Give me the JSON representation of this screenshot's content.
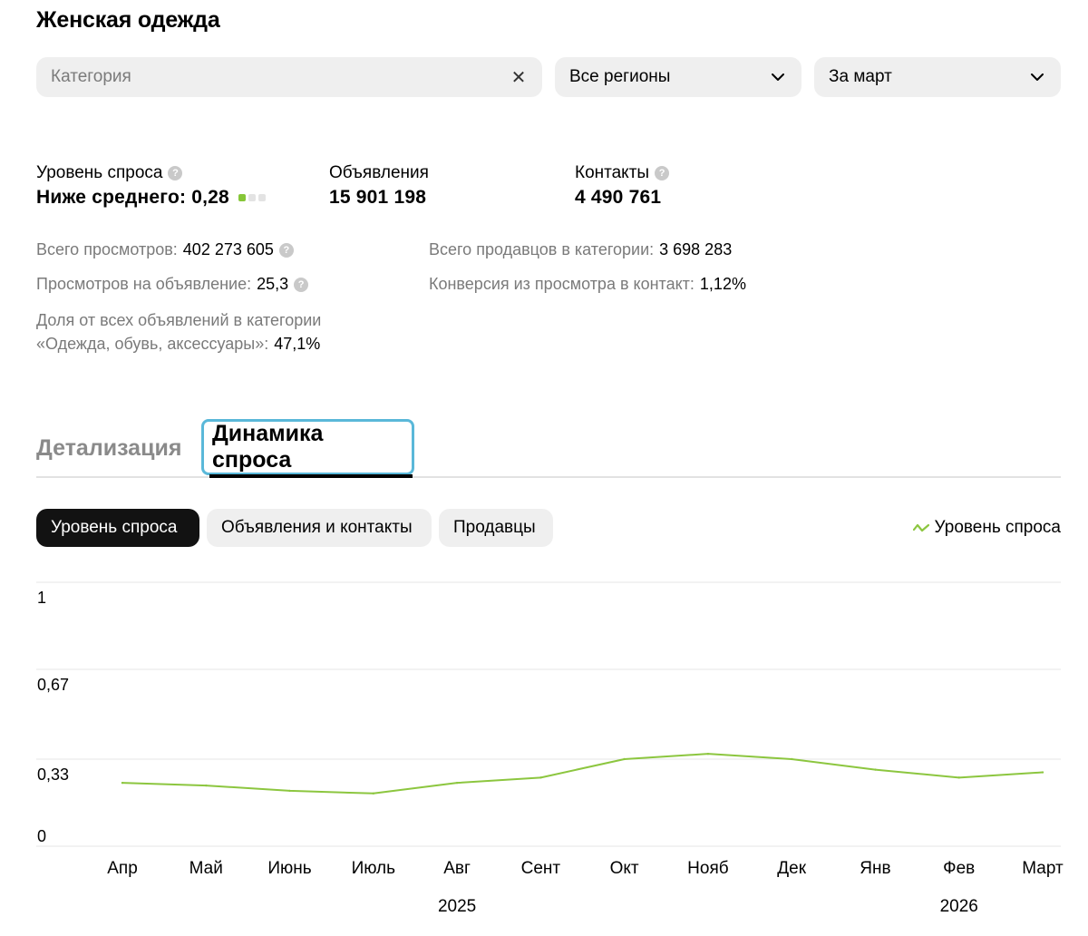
{
  "header": {
    "title": "Женская одежда"
  },
  "filters": {
    "category_placeholder": "Категория",
    "region": "Все регионы",
    "period": "За март"
  },
  "stats": {
    "demand_label": "Уровень спроса",
    "demand_value": "Ниже среднего: 0,28",
    "demand_level": 1,
    "demand_level_max": 3,
    "ads_label": "Объявления",
    "ads_value": "15 901 198",
    "contacts_label": "Контакты",
    "contacts_value": "4 490 761"
  },
  "metrics": {
    "views_label": "Всего просмотров:",
    "views_value": "402 273 605",
    "views_per_ad_label": "Просмотров на объявление:",
    "views_per_ad_value": "25,3",
    "share_label_line1": "Доля от всех объявлений в категории",
    "share_label_line2": "«Одежда, обувь, аксессуары»:",
    "share_value": "47,1%",
    "sellers_label": "Всего продавцов в категории:",
    "sellers_value": "3 698 283",
    "conversion_label": "Конверсия из просмотра в контакт:",
    "conversion_value": "1,12%"
  },
  "tabs": [
    {
      "label": "Детализация",
      "active": false
    },
    {
      "label": "Динамика спроса",
      "active": true
    }
  ],
  "chips": [
    {
      "label": "Уровень спроса",
      "active": true
    },
    {
      "label": "Объявления и контакты",
      "active": false
    },
    {
      "label": "Продавцы",
      "active": false
    }
  ],
  "legend": {
    "label": "Уровень спроса",
    "color": "#8cc63f"
  },
  "chart_data": {
    "type": "line",
    "categories": [
      "Апр",
      "Май",
      "Июнь",
      "Июль",
      "Авг",
      "Сент",
      "Окт",
      "Нояб",
      "Дек",
      "Янв",
      "Фев",
      "Март"
    ],
    "years": [
      {
        "label": "2025",
        "under": "Авг"
      },
      {
        "label": "2026",
        "under": "Фев"
      }
    ],
    "series": [
      {
        "name": "Уровень спроса",
        "color": "#8cc63f",
        "values": [
          0.24,
          0.23,
          0.21,
          0.2,
          0.24,
          0.26,
          0.33,
          0.35,
          0.33,
          0.29,
          0.26,
          0.28
        ]
      }
    ],
    "yticks": [
      {
        "value": 0,
        "label": "0"
      },
      {
        "value": 0.33,
        "label": "0,33"
      },
      {
        "value": 0.67,
        "label": "0,67"
      },
      {
        "value": 1,
        "label": "1"
      }
    ],
    "ylim": [
      0,
      1
    ],
    "grid": true
  }
}
